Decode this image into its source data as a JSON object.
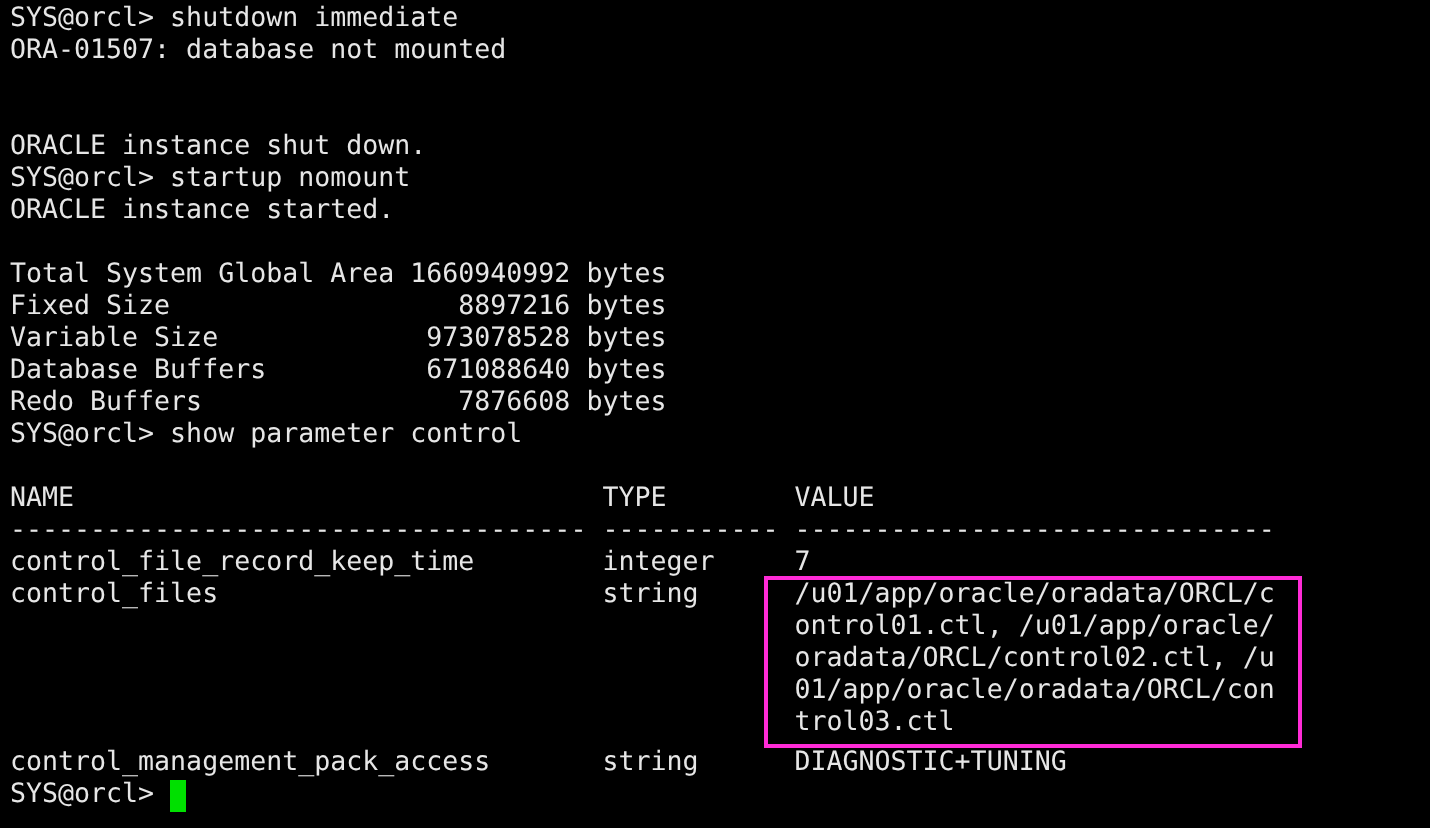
{
  "lines": [
    {
      "kind": "text",
      "text": "SYS@orcl> shutdown immediate"
    },
    {
      "kind": "text",
      "text": "ORA-01507: database not mounted"
    },
    {
      "kind": "blank"
    },
    {
      "kind": "blank"
    },
    {
      "kind": "text",
      "text": "ORACLE instance shut down."
    },
    {
      "kind": "text",
      "text": "SYS@orcl> startup nomount"
    },
    {
      "kind": "text",
      "text": "ORACLE instance started."
    },
    {
      "kind": "blank"
    },
    {
      "kind": "text",
      "text": "Total System Global Area 1660940992 bytes"
    },
    {
      "kind": "text",
      "text": "Fixed Size                  8897216 bytes"
    },
    {
      "kind": "text",
      "text": "Variable Size             973078528 bytes"
    },
    {
      "kind": "text",
      "text": "Database Buffers          671088640 bytes"
    },
    {
      "kind": "text",
      "text": "Redo Buffers                7876608 bytes"
    },
    {
      "kind": "text",
      "text": "SYS@orcl> show parameter control"
    },
    {
      "kind": "blank"
    }
  ],
  "table": {
    "columns": [
      {
        "name": "NAME",
        "rule": "------------------------------------"
      },
      {
        "name": "TYPE",
        "rule": "-----------"
      },
      {
        "name": "VALUE",
        "rule": "------------------------------"
      }
    ],
    "rows": [
      {
        "name": "control_file_record_keep_time",
        "type": "integer",
        "value": [
          "7"
        ],
        "highlighted": false
      },
      {
        "name": "control_files",
        "type": "string",
        "value": [
          "/u01/app/oracle/oradata/ORCL/c",
          "ontrol01.ctl, /u01/app/oracle/",
          "oradata/ORCL/control02.ctl, /u",
          "01/app/oracle/oradata/ORCL/con",
          "trol03.ctl"
        ],
        "highlighted": true
      },
      {
        "name": "control_management_pack_access",
        "type": "string",
        "value": [
          "DIAGNOSTIC+TUNING"
        ],
        "highlighted": false
      }
    ]
  },
  "prompt": {
    "text": "SYS@orcl>",
    "cursor": true
  }
}
